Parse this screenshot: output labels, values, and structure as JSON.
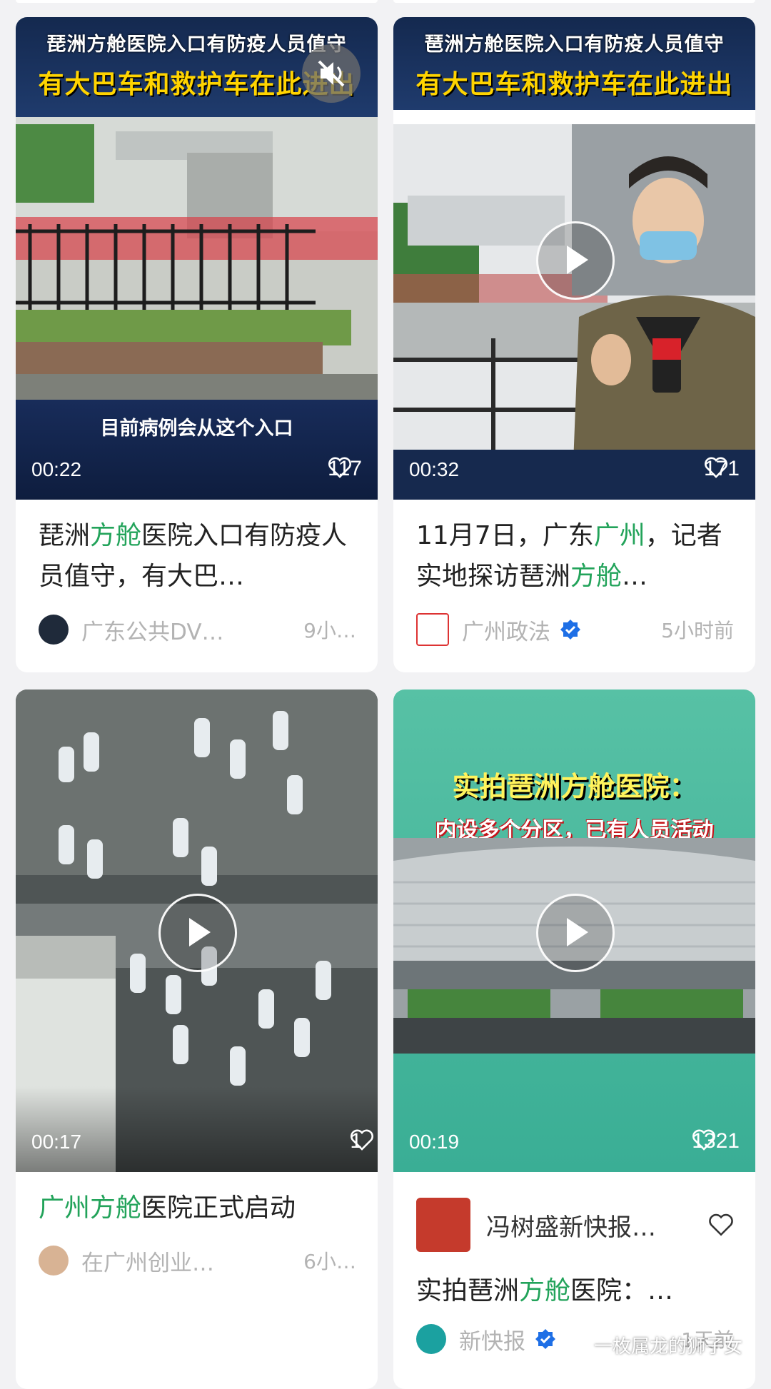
{
  "cards": [
    {
      "caption_top_1": "琵洲方舱医院入口有防疫人员值守",
      "caption_top_2": "有大巴车和救护车在此进出",
      "caption_bottom": "目前病例会从这个入口",
      "duration": "00:22",
      "likes": "117",
      "title": {
        "t1": "琵洲",
        "h1": "方舱",
        "t2": "医院入口有防疫人员值守，有大巴…"
      },
      "author": "广东公共DV…",
      "time": "9小…"
    },
    {
      "caption_top_1": "琶洲方舱医院入口有防疫人员值守",
      "caption_top_2": "有大巴车和救护车在此进出",
      "duration": "00:32",
      "likes": "171",
      "title": {
        "t1": "11月7日，广东",
        "h1": "广州",
        "t2": "，记者实地探访琶洲",
        "h2": "方舱",
        "t3": "…"
      },
      "author": "广州政法",
      "time": "5小时前"
    },
    {
      "duration": "00:17",
      "likes": "1",
      "title": {
        "h1": "广州方舱",
        "t1": "医院正式启动"
      },
      "author": "在广州创业…",
      "time": "6小…"
    },
    {
      "caption_top_1": "实拍琶洲方舱医院：",
      "caption_top_2": "内设多个分区，已有人员活动",
      "duration": "00:19",
      "likes": "1321",
      "channel": "冯树盛新快报…",
      "title": {
        "t1": "实拍琶洲",
        "h1": "方舱",
        "t2": "医院：…"
      },
      "author": "新快报",
      "time": "1天前"
    }
  ],
  "watermark": "一枚属龙的狮子女",
  "colors": {
    "highlight": "#22a35a",
    "background": "#f2f2f4",
    "verified": "#1e6fe6"
  }
}
